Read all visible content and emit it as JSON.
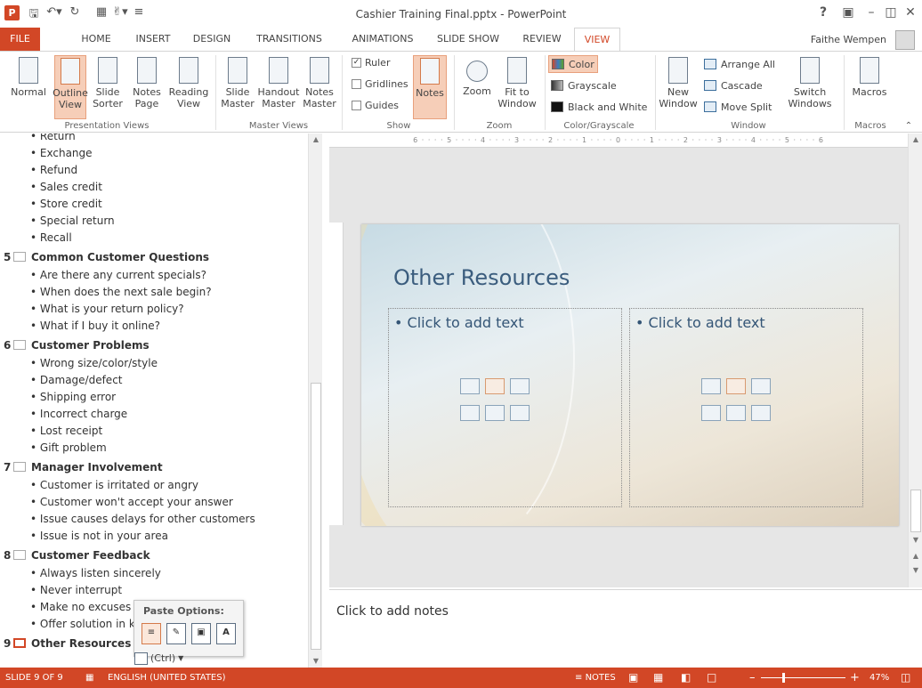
{
  "app": {
    "window_title": "Cashier Training Final.pptx - PowerPoint",
    "help_label": "?",
    "window_controls": [
      "restore-ribbon",
      "minimize",
      "maximize",
      "close"
    ],
    "user_name": "Faithe Wempen"
  },
  "qat": {
    "save": "save-icon",
    "undo": "undo-icon",
    "redo": "redo-icon"
  },
  "tabs": [
    {
      "label": "FILE"
    },
    {
      "label": "HOME"
    },
    {
      "label": "INSERT"
    },
    {
      "label": "DESIGN"
    },
    {
      "label": "TRANSITIONS"
    },
    {
      "label": "ANIMATIONS"
    },
    {
      "label": "SLIDE SHOW"
    },
    {
      "label": "REVIEW"
    },
    {
      "label": "VIEW",
      "active": true
    }
  ],
  "ribbon": {
    "presentation_views": {
      "label": "Presentation Views",
      "buttons": [
        {
          "label": "Normal"
        },
        {
          "label": "Outline View",
          "selected": true
        },
        {
          "label": "Slide Sorter"
        },
        {
          "label": "Notes Page"
        },
        {
          "label": "Reading View"
        }
      ]
    },
    "master_views": {
      "label": "Master Views",
      "buttons": [
        {
          "label": "Slide Master"
        },
        {
          "label": "Handout Master"
        },
        {
          "label": "Notes Master"
        }
      ]
    },
    "show": {
      "label": "Show",
      "ruler": {
        "label": "Ruler",
        "checked": true
      },
      "gridlines": {
        "label": "Gridlines",
        "checked": false
      },
      "guides": {
        "label": "Guides",
        "checked": false
      },
      "notes": {
        "label": "Notes",
        "selected": true
      }
    },
    "zoom": {
      "label": "Zoom",
      "zoom_btn": "Zoom",
      "fit_btn": "Fit to Window"
    },
    "color_grayscale": {
      "label": "Color/Grayscale",
      "color": "Color",
      "grayscale": "Grayscale",
      "bw": "Black and White"
    },
    "window": {
      "label": "Window",
      "new_window": "New Window",
      "arrange_all": "Arrange All",
      "cascade": "Cascade",
      "move_split": "Move Split",
      "switch_windows": "Switch Windows"
    },
    "macros": {
      "label": "Macros",
      "btn": "Macros"
    }
  },
  "outline": {
    "lines": [
      {
        "kind": "bullet",
        "text": "Return"
      },
      {
        "kind": "bullet",
        "text": "Exchange"
      },
      {
        "kind": "bullet",
        "text": "Refund"
      },
      {
        "kind": "bullet",
        "text": "Sales credit"
      },
      {
        "kind": "bullet",
        "text": "Store credit"
      },
      {
        "kind": "bullet",
        "text": "Special return"
      },
      {
        "kind": "bullet",
        "text": "Recall"
      },
      {
        "kind": "slide",
        "num": "5",
        "text": "Common Customer Questions"
      },
      {
        "kind": "bullet",
        "text": "Are there any current specials?"
      },
      {
        "kind": "bullet",
        "text": "When does the next sale begin?"
      },
      {
        "kind": "bullet",
        "text": "What is your return policy?"
      },
      {
        "kind": "bullet",
        "text": "What if I buy it online?"
      },
      {
        "kind": "slide",
        "num": "6",
        "text": "Customer Problems"
      },
      {
        "kind": "bullet",
        "text": "Wrong size/color/style"
      },
      {
        "kind": "bullet",
        "text": "Damage/defect"
      },
      {
        "kind": "bullet",
        "text": "Shipping error"
      },
      {
        "kind": "bullet",
        "text": "Incorrect charge"
      },
      {
        "kind": "bullet",
        "text": "Lost receipt"
      },
      {
        "kind": "bullet",
        "text": "Gift problem"
      },
      {
        "kind": "slide",
        "num": "7",
        "text": "Manager Involvement"
      },
      {
        "kind": "bullet",
        "text": "Customer is irritated or angry"
      },
      {
        "kind": "bullet",
        "text": "Customer won't accept your answer"
      },
      {
        "kind": "bullet",
        "text": "Issue causes delays for other customers"
      },
      {
        "kind": "bullet",
        "text": "Issue is not in your area"
      },
      {
        "kind": "slide",
        "num": "8",
        "text": "Customer Feedback"
      },
      {
        "kind": "bullet",
        "text": "Always listen sincerely"
      },
      {
        "kind": "bullet",
        "text": "Never interrupt"
      },
      {
        "kind": "bullet",
        "text": "Make no excuses"
      },
      {
        "kind": "bullet",
        "text": "Offer solution in k"
      },
      {
        "kind": "slide",
        "num": "9",
        "text": "Other Resources",
        "selected": true
      }
    ],
    "paste_options_title": "Paste Options:",
    "ctrl_badge": "(Ctrl)",
    "level_marker": "1"
  },
  "slide": {
    "title": "Other Resources",
    "left_placeholder": "Click to add text",
    "right_placeholder": "Click to add text",
    "ruler_marks": "6 · · · · 5 · · · · 4 · · · · 3 · · · · 2 · · · · 1 · · · · 0 · · · · 1 · · · · 2 · · · · 3 · · · · 4 · · · · 5 · · · · 6"
  },
  "notes": {
    "placeholder": "Click to add notes"
  },
  "status": {
    "slide_info": "SLIDE 9 OF 9",
    "language": "ENGLISH (UNITED STATES)",
    "notes_btn": "NOTES",
    "zoom_pct": "47%"
  },
  "colors": {
    "accent": "#d24726",
    "selected_bg": "#f6ceb8",
    "slide_title": "#3b5d7e"
  }
}
